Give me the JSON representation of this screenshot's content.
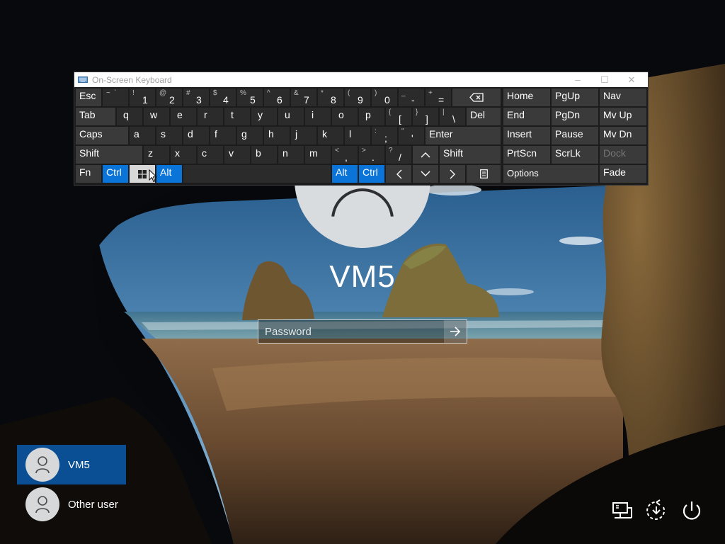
{
  "osk": {
    "title": "On-Screen Keyboard",
    "window_controls": {
      "minimize": "–",
      "maximize": "☐",
      "close": "✕"
    },
    "rows": [
      [
        {
          "label": "Esc"
        },
        {
          "sub": "~",
          "sub2": "`",
          "main": ""
        },
        {
          "sub": "!",
          "main": "1"
        },
        {
          "sub": "@",
          "main": "2"
        },
        {
          "sub": "#",
          "main": "3"
        },
        {
          "sub": "$",
          "main": "4"
        },
        {
          "sub": "%",
          "main": "5"
        },
        {
          "sub": "^",
          "main": "6"
        },
        {
          "sub": "&",
          "main": "7"
        },
        {
          "sub": "*",
          "main": "8"
        },
        {
          "sub": "(",
          "main": "9"
        },
        {
          "sub": ")",
          "main": "0"
        },
        {
          "sub": "_",
          "main": "-"
        },
        {
          "sub": "+",
          "main": "="
        },
        {
          "icon": "backspace-icon"
        }
      ],
      [
        {
          "label": "Tab"
        },
        {
          "label": "q"
        },
        {
          "label": "w"
        },
        {
          "label": "e"
        },
        {
          "label": "r"
        },
        {
          "label": "t"
        },
        {
          "label": "y"
        },
        {
          "label": "u"
        },
        {
          "label": "i"
        },
        {
          "label": "o"
        },
        {
          "label": "p"
        },
        {
          "sub": "{",
          "main": "["
        },
        {
          "sub": "}",
          "main": "]"
        },
        {
          "sub": "|",
          "main": "\\"
        },
        {
          "label": "Del"
        }
      ],
      [
        {
          "label": "Caps"
        },
        {
          "label": "a"
        },
        {
          "label": "s"
        },
        {
          "label": "d"
        },
        {
          "label": "f"
        },
        {
          "label": "g"
        },
        {
          "label": "h"
        },
        {
          "label": "j"
        },
        {
          "label": "k"
        },
        {
          "label": "l"
        },
        {
          "sub": ":",
          "main": ";"
        },
        {
          "sub": "\"",
          "main": "'"
        },
        {
          "label": "Enter"
        }
      ],
      [
        {
          "label": "Shift"
        },
        {
          "label": "z"
        },
        {
          "label": "x"
        },
        {
          "label": "c"
        },
        {
          "label": "v"
        },
        {
          "label": "b"
        },
        {
          "label": "n"
        },
        {
          "label": "m"
        },
        {
          "sub": "<",
          "main": ","
        },
        {
          "sub": ">",
          "main": "."
        },
        {
          "sub": "?",
          "main": "/"
        },
        {
          "icon": "arrow-up-icon"
        },
        {
          "label": "Shift"
        }
      ],
      [
        {
          "label": "Fn"
        },
        {
          "label": "Ctrl"
        },
        {
          "icon": "windows-icon"
        },
        {
          "label": "Alt"
        },
        {
          "label": ""
        },
        {
          "label": "Alt"
        },
        {
          "label": "Ctrl"
        },
        {
          "icon": "arrow-left-icon"
        },
        {
          "icon": "arrow-down-icon"
        },
        {
          "icon": "arrow-right-icon"
        },
        {
          "icon": "menu-icon"
        }
      ]
    ],
    "nav_keys": {
      "row1": [
        "Home",
        "PgUp",
        "Nav"
      ],
      "row2": [
        "End",
        "PgDn",
        "Mv Up"
      ],
      "row3": [
        "Insert",
        "Pause",
        "Mv Dn"
      ],
      "row4": [
        "PrtScn",
        "ScrLk",
        "Dock"
      ],
      "row5": [
        "Options",
        "Fade"
      ]
    }
  },
  "login": {
    "machine_name": "VM5",
    "password_placeholder": "Password",
    "submit_icon": "arrow-right-icon"
  },
  "users": [
    {
      "name": "VM5",
      "selected": true
    },
    {
      "name": "Other user",
      "selected": false
    }
  ],
  "corner_icons": [
    "network-icon",
    "ease-of-access-icon",
    "power-icon"
  ],
  "colors": {
    "accent": "#0a74d8",
    "user_selected": "#0a4f94",
    "key_bg": "#3a3a3a",
    "keyboard_bg": "#1c1c1c"
  }
}
